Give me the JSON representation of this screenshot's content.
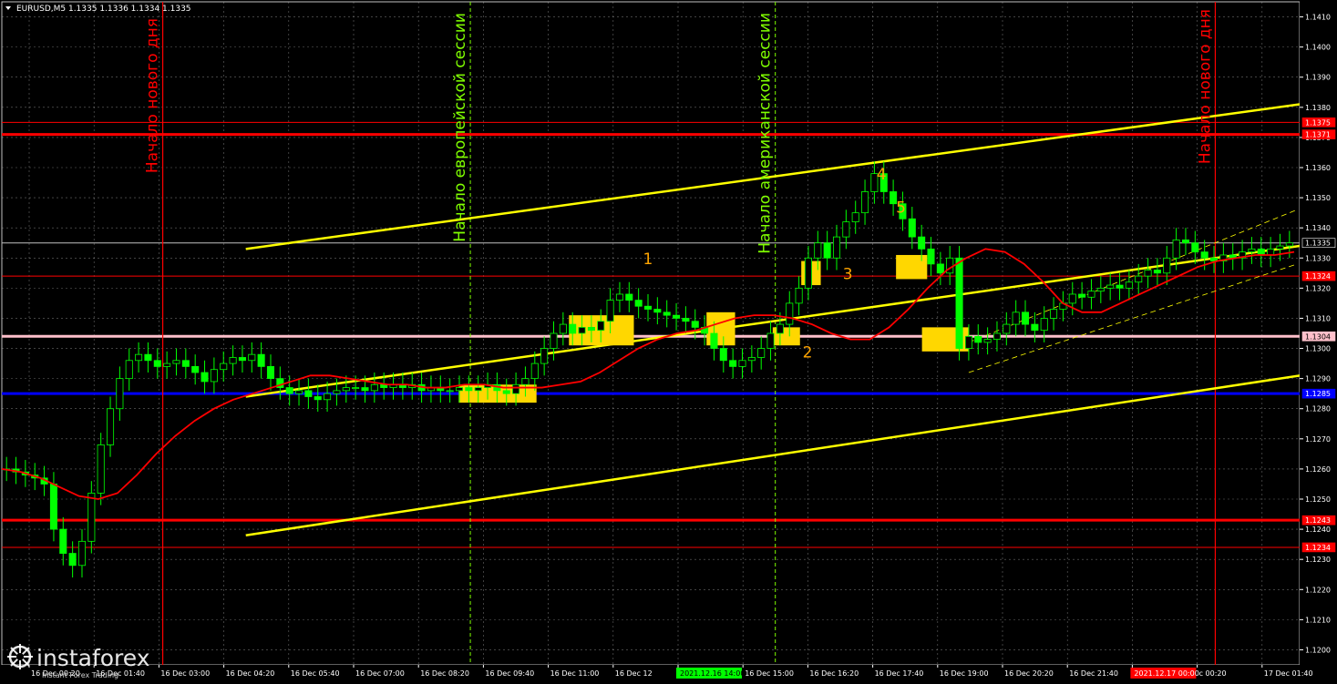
{
  "header": {
    "symbol_info": "EURUSD,M5  1.1335 1.1336 1.1334 1.1335"
  },
  "colors": {
    "background": "#000000",
    "grid": "#c0c0c0",
    "candle": "#00ff00",
    "ma": "#ff0000",
    "trendline": "#ffff00",
    "level_red": "#ff0000",
    "level_blue": "#0000ff",
    "level_pink": "#ffc0cb",
    "signal_box": "#ffd700",
    "text_red": "#ff0000",
    "text_green": "#80ff00",
    "text_orange": "#ffa500",
    "axis_text": "#ffffff"
  },
  "vertical_labels": [
    {
      "text": "Начало нового дня",
      "color": "#ff0000"
    },
    {
      "text": "Начало европейской сессии",
      "color": "#80ff00"
    },
    {
      "text": "Начало американской сессии",
      "color": "#80ff00"
    },
    {
      "text": "Начало нового дня",
      "color": "#ff0000"
    }
  ],
  "signal_numbers": [
    "1",
    "2",
    "3",
    "4",
    "5"
  ],
  "price_labels": [
    {
      "text": "1.1375",
      "bg": "#ff0000"
    },
    {
      "text": "1.1371",
      "bg": "#ff0000"
    },
    {
      "text": "1.1335",
      "bg": "#000000"
    },
    {
      "text": "1.1324",
      "bg": "#ff0000"
    },
    {
      "text": "1.1304",
      "bg": "#ffc0cb"
    },
    {
      "text": "1.1285",
      "bg": "#0000ff"
    },
    {
      "text": "1.1243",
      "bg": "#ff0000"
    },
    {
      "text": "1.1234",
      "bg": "#ff0000"
    }
  ],
  "time_labels": [
    "16 Dec 00:20",
    "16 Dec 01:40",
    "16 Dec 03:00",
    "16 Dec 04:20",
    "16 Dec 05:40",
    "16 Dec 07:00",
    "16 Dec 08:20",
    "16 Dec 09:40",
    "16 Dec 11:00",
    "16 Dec 12",
    "2021.12.16 14:00",
    "16 Dec 15:00",
    "16 Dec 16:20",
    "16 Dec 17:40",
    "16 Dec 19:00",
    "16 Dec 20:20",
    "16 Dec 21:40",
    "2021.12.17 00:00",
    "c 00:20",
    "17 Dec 01:40"
  ],
  "watermark": {
    "brand": "instaforex",
    "tagline": "Instant Forex Trading"
  },
  "chart_data": {
    "type": "candlestick",
    "title": "EURUSD,M5",
    "ylim": [
      1.1195,
      1.1415
    ],
    "y_ticks": [
      1.12,
      1.121,
      1.122,
      1.123,
      1.124,
      1.125,
      1.126,
      1.127,
      1.128,
      1.129,
      1.13,
      1.131,
      1.132,
      1.133,
      1.134,
      1.135,
      1.136,
      1.137,
      1.138,
      1.139,
      1.14,
      1.141
    ],
    "horizontal_levels": [
      {
        "price": 1.1375,
        "color": "#ff0000",
        "width": 1
      },
      {
        "price": 1.1371,
        "color": "#ff0000",
        "width": 3
      },
      {
        "price": 1.1324,
        "color": "#ff0000",
        "width": 1
      },
      {
        "price": 1.1304,
        "color": "#ffc0cb",
        "width": 3
      },
      {
        "price": 1.1285,
        "color": "#0000ff",
        "width": 3
      },
      {
        "price": 1.1243,
        "color": "#ff0000",
        "width": 3
      },
      {
        "price": 1.1234,
        "color": "#ff0000",
        "width": 1
      },
      {
        "price": 1.1335,
        "color": "#c0c0c0",
        "width": 1
      }
    ],
    "close_series": [
      1.126,
      1.1259,
      1.1258,
      1.1257,
      1.1255,
      1.124,
      1.1232,
      1.1228,
      1.1236,
      1.1252,
      1.1268,
      1.128,
      1.129,
      1.1296,
      1.1298,
      1.1296,
      1.1294,
      1.1295,
      1.1296,
      1.1294,
      1.1292,
      1.1289,
      1.1293,
      1.1295,
      1.1297,
      1.1296,
      1.1298,
      1.1294,
      1.129,
      1.1287,
      1.1285,
      1.1286,
      1.1284,
      1.1283,
      1.1285,
      1.1286,
      1.1287,
      1.1287,
      1.1286,
      1.1288,
      1.1287,
      1.1288,
      1.1287,
      1.1288,
      1.1286,
      1.1287,
      1.1286,
      1.1286,
      1.1287,
      1.1286,
      1.1287,
      1.1288,
      1.1286,
      1.1285,
      1.1288,
      1.129,
      1.1295,
      1.13,
      1.1305,
      1.1308,
      1.1305,
      1.1307,
      1.1306,
      1.1309,
      1.1316,
      1.1318,
      1.1316,
      1.1314,
      1.1313,
      1.1312,
      1.1311,
      1.131,
      1.1309,
      1.1307,
      1.1305,
      1.13,
      1.1296,
      1.1294,
      1.1296,
      1.1297,
      1.13,
      1.1305,
      1.1308,
      1.1315,
      1.132,
      1.133,
      1.1335,
      1.133,
      1.1337,
      1.1342,
      1.1345,
      1.1352,
      1.1358,
      1.1352,
      1.1348,
      1.1343,
      1.1337,
      1.1333,
      1.1328,
      1.1325,
      1.133,
      1.13,
      1.1304,
      1.1302,
      1.1303,
      1.1305,
      1.1308,
      1.1312,
      1.1308,
      1.1306,
      1.131,
      1.1313,
      1.1315,
      1.1318,
      1.1317,
      1.1319,
      1.132,
      1.1321,
      1.132,
      1.1322,
      1.1324,
      1.1326,
      1.1325,
      1.133,
      1.1336,
      1.1335,
      1.1332,
      1.133,
      1.1329,
      1.1331,
      1.133,
      1.1332,
      1.1333,
      1.1331,
      1.1333,
      1.1334,
      1.1335
    ],
    "ma_series": [
      1.126,
      1.1259,
      1.1257,
      1.1254,
      1.1251,
      1.125,
      1.1252,
      1.1258,
      1.1265,
      1.1271,
      1.1276,
      1.128,
      1.1283,
      1.1285,
      1.1287,
      1.1289,
      1.1291,
      1.1291,
      1.129,
      1.1289,
      1.1288,
      1.1288,
      1.1287,
      1.1287,
      1.1288,
      1.1288,
      1.1287,
      1.1287,
      1.1287,
      1.1288,
      1.1289,
      1.1292,
      1.1296,
      1.13,
      1.1303,
      1.1305,
      1.1306,
      1.1308,
      1.131,
      1.1311,
      1.1311,
      1.131,
      1.1308,
      1.1305,
      1.1303,
      1.1303,
      1.1307,
      1.1313,
      1.132,
      1.1326,
      1.133,
      1.1333,
      1.1332,
      1.1328,
      1.1322,
      1.1315,
      1.1312,
      1.1312,
      1.1315,
      1.1318,
      1.1321,
      1.1324,
      1.1327,
      1.1329,
      1.133,
      1.1331,
      1.1331,
      1.1332
    ],
    "trendlines": [
      {
        "from": [
          0.188,
          1.1333
        ],
        "to": [
          1.0,
          1.1381
        ]
      },
      {
        "from": [
          0.188,
          1.1284
        ],
        "to": [
          1.0,
          1.1334
        ]
      },
      {
        "from": [
          0.188,
          1.1238
        ],
        "to": [
          1.0,
          1.1291
        ]
      }
    ],
    "signal_boxes": [
      {
        "t0": 0.352,
        "t1": 0.412,
        "p0": 1.1288,
        "p1": 1.1282
      },
      {
        "t0": 0.437,
        "t1": 0.487,
        "p0": 1.1311,
        "p1": 1.1301
      },
      {
        "t0": 0.543,
        "t1": 0.565,
        "p0": 1.1312,
        "p1": 1.1301
      },
      {
        "t0": 0.594,
        "t1": 0.615,
        "p0": 1.1307,
        "p1": 1.1301
      },
      {
        "t0": 0.616,
        "t1": 0.631,
        "p0": 1.1329,
        "p1": 1.1321
      },
      {
        "t0": 0.689,
        "t1": 0.713,
        "p0": 1.1331,
        "p1": 1.1323
      },
      {
        "t0": 0.709,
        "t1": 0.745,
        "p0": 1.1307,
        "p1": 1.1299
      }
    ]
  }
}
